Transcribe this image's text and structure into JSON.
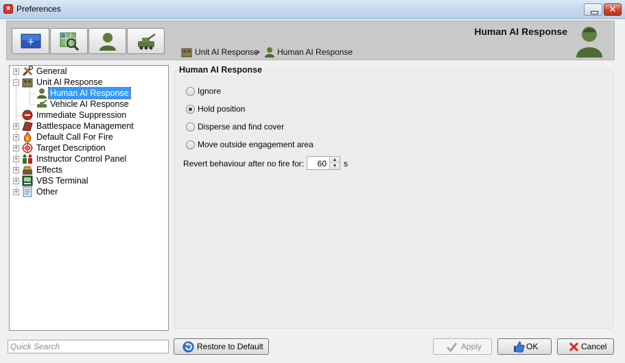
{
  "window": {
    "title": "Preferences",
    "controls": {
      "minimize": "minimize",
      "close": "close"
    }
  },
  "header": {
    "title": "Human AI Response",
    "toolbar": [
      "plus-icon",
      "map-search-icon",
      "soldier-icon",
      "vehicle-icon"
    ],
    "breadcrumb": {
      "parent": "Unit AI Response",
      "separator": ">",
      "current": "Human AI Response"
    }
  },
  "tree": {
    "items": [
      {
        "label": "General",
        "icon": "tools-icon"
      },
      {
        "label": "Unit AI Response",
        "icon": "unit-icon"
      },
      {
        "label": "Human AI Response",
        "icon": "soldier-icon",
        "selected": true
      },
      {
        "label": "Vehicle AI Response",
        "icon": "vehicle-icon"
      },
      {
        "label": "Immediate Suppression",
        "icon": "suppression-icon"
      },
      {
        "label": "Battlespace Management",
        "icon": "battlespace-icon"
      },
      {
        "label": "Default Call For Fire",
        "icon": "fire-icon"
      },
      {
        "label": "Target Description",
        "icon": "target-icon"
      },
      {
        "label": "Instructor Control Panel",
        "icon": "instructor-icon"
      },
      {
        "label": "Effects",
        "icon": "effects-icon"
      },
      {
        "label": "VBS Terminal",
        "icon": "terminal-icon"
      },
      {
        "label": "Other",
        "icon": "other-icon"
      }
    ]
  },
  "main": {
    "section_title": "Human AI Response",
    "options": [
      {
        "label": "Ignore",
        "checked": false
      },
      {
        "label": "Hold position",
        "checked": true
      },
      {
        "label": "Disperse and find cover",
        "checked": false
      },
      {
        "label": "Move outside engagement area",
        "checked": false
      }
    ],
    "revert": {
      "label": "Revert behaviour after no fire for:",
      "value": "60",
      "unit": "s"
    }
  },
  "footer": {
    "search_placeholder": "Quick Search",
    "restore_label": "Restore to Default",
    "apply_label": "Apply",
    "ok_label": "OK",
    "cancel_label": "Cancel"
  },
  "colors": {
    "selection": "#3399ff",
    "header_bg": "#c9c9c9",
    "title_bar": "#c6d8ee"
  }
}
